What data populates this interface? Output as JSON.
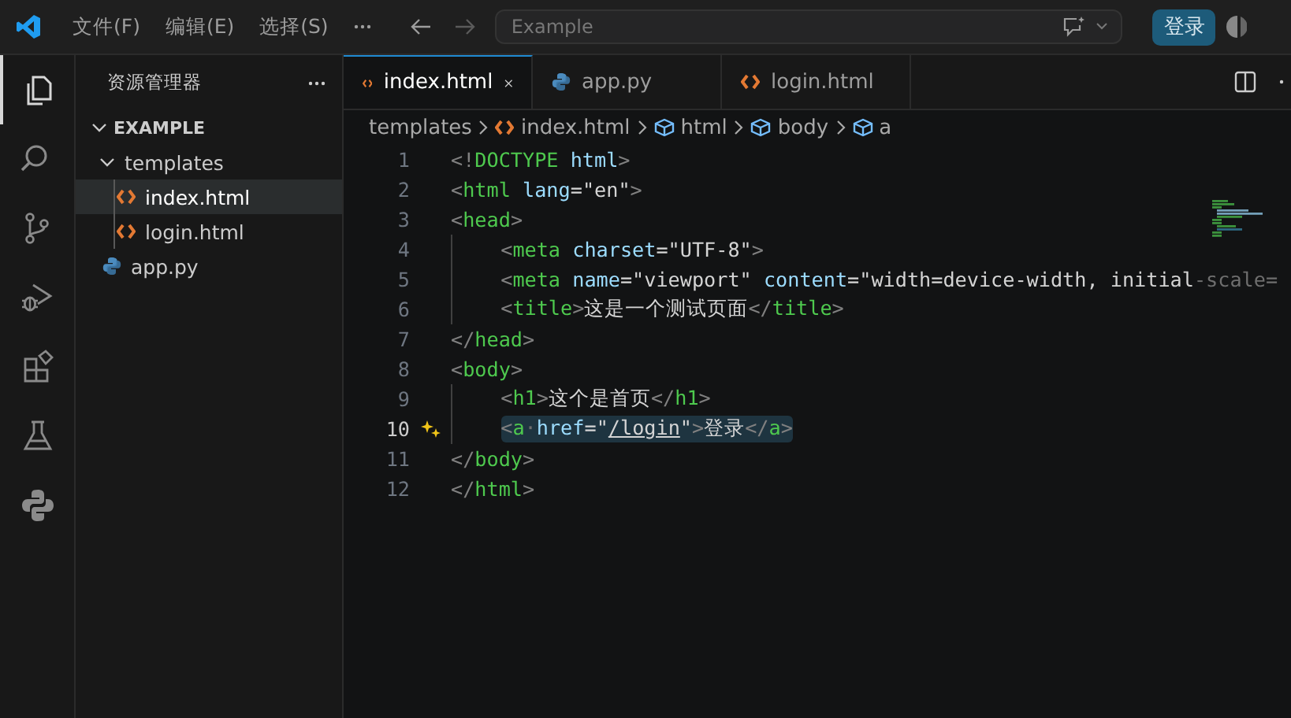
{
  "title_bar": {
    "menu": [
      "文件(F)",
      "编辑(E)",
      "选择(S)"
    ],
    "search": {
      "value": "Example"
    },
    "login_button": "登录"
  },
  "activity_bar": [
    {
      "kind": "explorer",
      "selected": true
    },
    {
      "kind": "search",
      "selected": false
    },
    {
      "kind": "source-control",
      "selected": false
    },
    {
      "kind": "run-debug",
      "selected": false
    },
    {
      "kind": "extensions",
      "selected": false
    },
    {
      "kind": "testing",
      "selected": false
    },
    {
      "kind": "python",
      "selected": false
    }
  ],
  "sidebar": {
    "title": "资源管理器",
    "tree": [
      {
        "label": "EXAMPLE",
        "kind": "root",
        "expanded": true,
        "children": [
          {
            "label": "templates",
            "kind": "folder",
            "expanded": true,
            "selected": false,
            "children": [
              {
                "label": "index.html",
                "kind": "html",
                "selected": true
              },
              {
                "label": "login.html",
                "kind": "html",
                "selected": false
              }
            ]
          },
          {
            "label": "app.py",
            "kind": "python",
            "selected": false
          }
        ]
      }
    ]
  },
  "tabs": [
    {
      "label": "index.html",
      "kind": "html",
      "selected": true
    },
    {
      "label": "app.py",
      "kind": "python",
      "selected": false
    },
    {
      "label": "login.html",
      "kind": "html",
      "selected": false
    }
  ],
  "breadcrumbs": [
    {
      "label": "templates",
      "kind": "folder"
    },
    {
      "label": "index.html",
      "kind": "html"
    },
    {
      "label": "html",
      "kind": "element"
    },
    {
      "label": "body",
      "kind": "element"
    },
    {
      "label": "a",
      "kind": "element"
    }
  ],
  "code": {
    "lines": [
      {
        "number": "1",
        "indent": false,
        "current": false,
        "tokens": [
          {
            "kind": "punct",
            "text": "<!"
          },
          {
            "kind": "tag",
            "text": "DOCTYPE"
          },
          {
            "kind": "attr",
            "text": " html"
          },
          {
            "kind": "punct",
            "text": ">"
          }
        ]
      },
      {
        "number": "2",
        "indent": false,
        "current": false,
        "tokens": [
          {
            "kind": "punct",
            "text": "<"
          },
          {
            "kind": "tag",
            "text": "html"
          },
          {
            "kind": "attr",
            "text": " lang"
          },
          {
            "kind": "text",
            "text": "="
          },
          {
            "kind": "string",
            "text": "\"en\""
          },
          {
            "kind": "punct",
            "text": ">"
          }
        ]
      },
      {
        "number": "3",
        "indent": false,
        "current": false,
        "tokens": [
          {
            "kind": "punct",
            "text": "<"
          },
          {
            "kind": "tag",
            "text": "head"
          },
          {
            "kind": "punct",
            "text": ">"
          }
        ]
      },
      {
        "number": "4",
        "indent": true,
        "current": false,
        "tokens": [
          {
            "kind": "punct",
            "text": "<"
          },
          {
            "kind": "tag",
            "text": "meta"
          },
          {
            "kind": "attr",
            "text": " charset"
          },
          {
            "kind": "text",
            "text": "="
          },
          {
            "kind": "string",
            "text": "\"UTF-8\""
          },
          {
            "kind": "punct",
            "text": ">"
          }
        ]
      },
      {
        "number": "5",
        "indent": true,
        "current": false,
        "tokens": [
          {
            "kind": "punct",
            "text": "<"
          },
          {
            "kind": "tag",
            "text": "meta"
          },
          {
            "kind": "attr",
            "text": " name"
          },
          {
            "kind": "text",
            "text": "="
          },
          {
            "kind": "string",
            "text": "\"viewport\""
          },
          {
            "kind": "attr",
            "text": " content"
          },
          {
            "kind": "text",
            "text": "="
          },
          {
            "kind": "string",
            "text": "\"width=device-width, initial"
          },
          {
            "kind": "faded",
            "text": "-scale="
          }
        ]
      },
      {
        "number": "6",
        "indent": true,
        "current": false,
        "tokens": [
          {
            "kind": "punct",
            "text": "<"
          },
          {
            "kind": "tag",
            "text": "title"
          },
          {
            "kind": "punct",
            "text": ">"
          },
          {
            "kind": "text",
            "text": "这是一个测试页面"
          },
          {
            "kind": "punct",
            "text": "</"
          },
          {
            "kind": "tag",
            "text": "title"
          },
          {
            "kind": "punct",
            "text": ">"
          }
        ]
      },
      {
        "number": "7",
        "indent": false,
        "current": false,
        "tokens": [
          {
            "kind": "punct",
            "text": "</"
          },
          {
            "kind": "tag",
            "text": "head"
          },
          {
            "kind": "punct",
            "text": ">"
          }
        ]
      },
      {
        "number": "8",
        "indent": false,
        "current": false,
        "tokens": [
          {
            "kind": "punct",
            "text": "<"
          },
          {
            "kind": "tag",
            "text": "body"
          },
          {
            "kind": "punct",
            "text": ">"
          }
        ]
      },
      {
        "number": "9",
        "indent": true,
        "current": false,
        "tokens": [
          {
            "kind": "punct",
            "text": "<"
          },
          {
            "kind": "tag",
            "text": "h1"
          },
          {
            "kind": "punct",
            "text": ">"
          },
          {
            "kind": "text",
            "text": "这个是首页"
          },
          {
            "kind": "punct",
            "text": "</"
          },
          {
            "kind": "tag",
            "text": "h1"
          },
          {
            "kind": "punct",
            "text": ">"
          }
        ]
      },
      {
        "number": "10",
        "indent": true,
        "current": true,
        "tokens": [
          {
            "kind": "punct",
            "text": "<"
          },
          {
            "kind": "tag",
            "text": "a"
          },
          {
            "kind": "faded",
            "text": "·"
          },
          {
            "kind": "attr",
            "text": "href"
          },
          {
            "kind": "text",
            "text": "="
          },
          {
            "kind": "string",
            "text": "\""
          },
          {
            "kind": "link",
            "text": "/login"
          },
          {
            "kind": "string",
            "text": "\""
          },
          {
            "kind": "punct",
            "text": ">"
          },
          {
            "kind": "text",
            "text": "登录"
          },
          {
            "kind": "punct",
            "text": "</"
          },
          {
            "kind": "tag",
            "text": "a"
          },
          {
            "kind": "punct",
            "text": ">"
          }
        ]
      },
      {
        "number": "11",
        "indent": false,
        "current": false,
        "tokens": [
          {
            "kind": "punct",
            "text": "</"
          },
          {
            "kind": "tag",
            "text": "body"
          },
          {
            "kind": "punct",
            "text": ">"
          }
        ]
      },
      {
        "number": "12",
        "indent": false,
        "current": false,
        "tokens": [
          {
            "kind": "punct",
            "text": "</"
          },
          {
            "kind": "tag",
            "text": "html"
          },
          {
            "kind": "punct",
            "text": ">"
          }
        ]
      }
    ]
  }
}
